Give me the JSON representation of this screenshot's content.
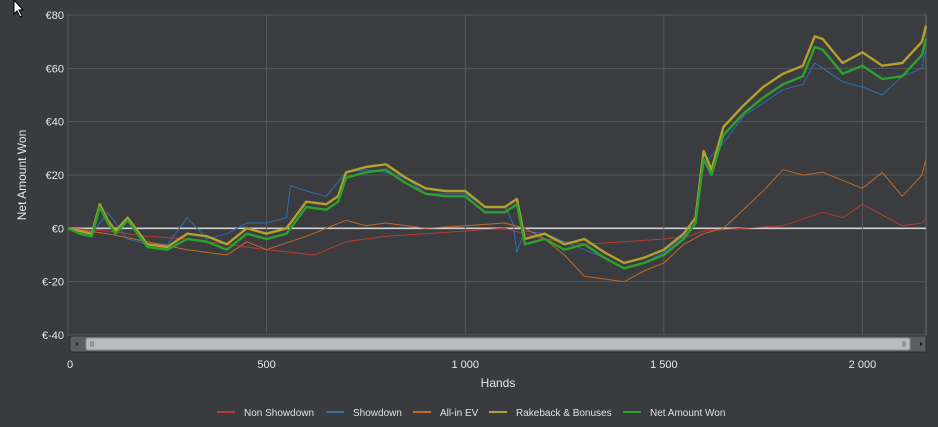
{
  "chart_data": {
    "type": "line",
    "xlabel": "Hands",
    "ylabel": "Net Amount Won",
    "xlim": [
      0,
      2160
    ],
    "ylim": [
      -40,
      80
    ],
    "x_ticks": [
      {
        "value": 0,
        "label": "0"
      },
      {
        "value": 500,
        "label": "500"
      },
      {
        "value": 1000,
        "label": "1 000"
      },
      {
        "value": 1500,
        "label": "1 500"
      },
      {
        "value": 2000,
        "label": "2 000"
      }
    ],
    "y_ticks": [
      {
        "value": 80,
        "label": "€80"
      },
      {
        "value": 60,
        "label": "€60"
      },
      {
        "value": 40,
        "label": "€40"
      },
      {
        "value": 20,
        "label": "€20"
      },
      {
        "value": 0,
        "label": "€0"
      },
      {
        "value": -20,
        "label": "€-20"
      },
      {
        "value": -40,
        "label": "€-40"
      }
    ],
    "grid": true,
    "legend_position": "bottom",
    "series": [
      {
        "name": "Non Showdown",
        "color": "#b83a32",
        "x": [
          0,
          100,
          200,
          300,
          400,
          500,
          560,
          620,
          700,
          800,
          900,
          1000,
          1100,
          1150,
          1200,
          1300,
          1400,
          1500,
          1560,
          1600,
          1700,
          1800,
          1900,
          1950,
          2000,
          2050,
          2100,
          2150,
          2160
        ],
        "y": [
          0,
          -1,
          -3,
          -4,
          -6,
          -8,
          -9,
          -10,
          -5,
          -3,
          -2,
          -1,
          0,
          -2,
          -4,
          -6,
          -5,
          -4,
          -3,
          -1,
          0,
          1,
          6,
          4,
          9,
          5,
          1,
          2,
          4
        ]
      },
      {
        "name": "Showdown",
        "color": "#2e6fb0",
        "x": [
          0,
          60,
          100,
          150,
          200,
          250,
          300,
          350,
          400,
          450,
          500,
          550,
          560,
          600,
          650,
          700,
          750,
          800,
          850,
          900,
          950,
          1000,
          1050,
          1100,
          1120,
          1130,
          1150,
          1200,
          1250,
          1300,
          1350,
          1400,
          1450,
          1500,
          1550,
          1580,
          1600,
          1650,
          1700,
          1750,
          1800,
          1850,
          1880,
          1900,
          1950,
          2000,
          2050,
          2100,
          2150,
          2160
        ],
        "y": [
          0,
          -2,
          6,
          -4,
          -6,
          -6,
          4,
          -4,
          -2,
          2,
          2,
          4,
          16,
          14,
          12,
          21,
          22,
          21,
          19,
          13,
          13,
          13,
          8,
          8,
          2,
          -9,
          -1,
          -2,
          -5,
          -8,
          -11,
          -15,
          -13,
          -9,
          -3,
          2,
          24,
          32,
          42,
          47,
          52,
          54,
          62,
          60,
          55,
          53,
          50,
          57,
          60,
          68
        ]
      },
      {
        "name": "All-in EV",
        "color": "#c0692b",
        "x": [
          0,
          100,
          200,
          300,
          400,
          450,
          500,
          600,
          700,
          750,
          800,
          900,
          1000,
          1100,
          1150,
          1200,
          1250,
          1300,
          1350,
          1400,
          1450,
          1500,
          1550,
          1600,
          1650,
          1700,
          1750,
          1800,
          1850,
          1900,
          1950,
          2000,
          2050,
          2100,
          2150,
          2160
        ],
        "y": [
          0,
          -2,
          -5,
          -8,
          -10,
          -5,
          -8,
          -3,
          3,
          1,
          2,
          0,
          1,
          2,
          0,
          -4,
          -10,
          -18,
          -19,
          -20,
          -16,
          -13,
          -6,
          -2,
          0,
          7,
          14,
          22,
          20,
          21,
          18,
          15,
          21,
          12,
          20,
          26
        ]
      },
      {
        "name": "Rakeback & Bonuses",
        "color": "#b4a02e",
        "x": [
          0,
          30,
          60,
          80,
          100,
          120,
          150,
          200,
          250,
          300,
          350,
          400,
          450,
          500,
          550,
          600,
          650,
          680,
          700,
          750,
          800,
          850,
          900,
          950,
          1000,
          1050,
          1100,
          1130,
          1150,
          1200,
          1250,
          1300,
          1350,
          1400,
          1450,
          1500,
          1550,
          1580,
          1600,
          1620,
          1650,
          1700,
          1750,
          1800,
          1850,
          1880,
          1900,
          1950,
          2000,
          2050,
          2100,
          2150,
          2160
        ],
        "y": [
          0,
          -1,
          -2,
          9,
          3,
          -1,
          4,
          -6,
          -7,
          -2,
          -3,
          -6,
          0,
          -2,
          0,
          10,
          9,
          12,
          21,
          23,
          24,
          19,
          15,
          14,
          14,
          8,
          8,
          11,
          -4,
          -2,
          -6,
          -4,
          -9,
          -13,
          -11,
          -8,
          -2,
          4,
          29,
          22,
          38,
          46,
          53,
          58,
          61,
          72,
          71,
          62,
          66,
          61,
          62,
          70,
          76
        ]
      },
      {
        "name": "Net Amount Won",
        "color": "#2ea02e",
        "x": [
          0,
          30,
          60,
          80,
          100,
          120,
          150,
          200,
          250,
          300,
          350,
          400,
          450,
          500,
          550,
          600,
          650,
          680,
          700,
          750,
          800,
          850,
          900,
          950,
          1000,
          1050,
          1100,
          1130,
          1150,
          1200,
          1250,
          1300,
          1350,
          1400,
          1450,
          1500,
          1550,
          1580,
          1600,
          1620,
          1650,
          1700,
          1750,
          1800,
          1850,
          1880,
          1900,
          1950,
          2000,
          2050,
          2100,
          2150,
          2160
        ],
        "y": [
          0,
          -2,
          -3,
          8,
          2,
          -2,
          3,
          -7,
          -8,
          -4,
          -5,
          -8,
          -2,
          -4,
          -2,
          8,
          7,
          10,
          19,
          21,
          22,
          17,
          13,
          12,
          12,
          6,
          6,
          9,
          -6,
          -4,
          -8,
          -6,
          -11,
          -15,
          -13,
          -10,
          -4,
          2,
          26,
          20,
          35,
          43,
          49,
          54,
          57,
          68,
          67,
          58,
          61,
          56,
          57,
          65,
          71
        ]
      }
    ]
  }
}
